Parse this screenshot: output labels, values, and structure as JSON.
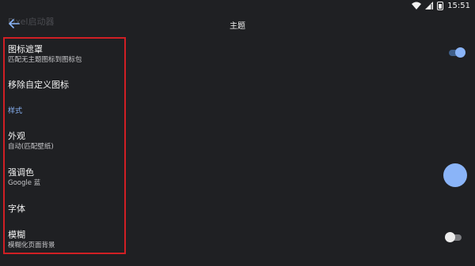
{
  "status": {
    "time": "15:51"
  },
  "header": {
    "ghost_text": "Pixel启动器",
    "title": "主题"
  },
  "items": {
    "icon_mask": {
      "title": "图标遮罩",
      "subtitle": "匹配无主题图标到图标包"
    },
    "remove_custom": {
      "title": "移除自定义图标"
    },
    "section_style": {
      "label": "样式"
    },
    "appearance": {
      "title": "外观",
      "subtitle": "自动(匹配壁纸)"
    },
    "accent": {
      "title": "强调色",
      "subtitle": "Google 蓝",
      "color": "#8ab4f8"
    },
    "font": {
      "title": "字体"
    },
    "blur": {
      "title": "模糊",
      "subtitle": "模糊化页面背景"
    }
  },
  "toggles": {
    "icon_mask_on": true,
    "blur_on": false
  },
  "icons": [
    "back-arrow-icon",
    "wifi-icon",
    "signal-icon",
    "battery-icon"
  ]
}
